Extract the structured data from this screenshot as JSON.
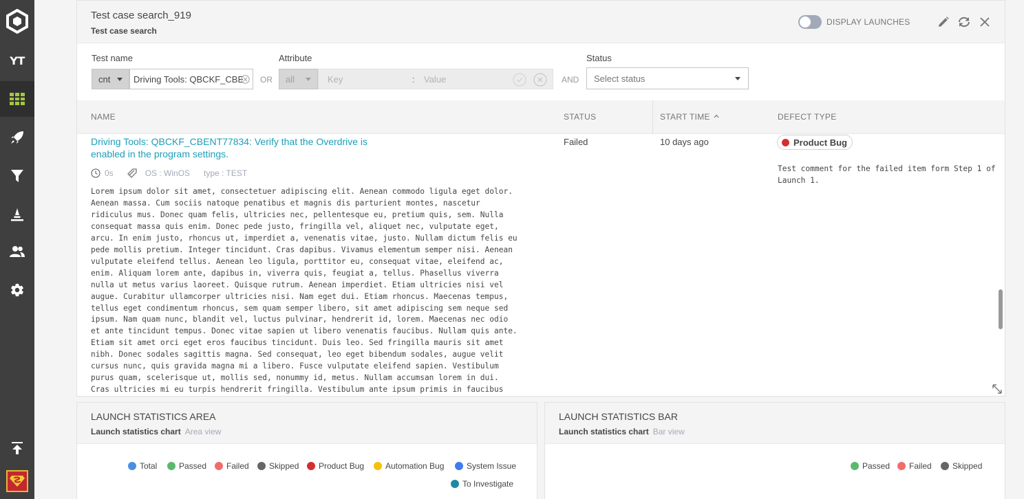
{
  "sidebar": {
    "project_initials": "YT",
    "items": [
      {
        "name": "dashboards",
        "icon": "dashboard-grid-icon",
        "active": true
      },
      {
        "name": "launches",
        "icon": "rocket-icon"
      },
      {
        "name": "filters",
        "icon": "filter-icon"
      },
      {
        "name": "debug",
        "icon": "debug-cone-icon"
      },
      {
        "name": "members",
        "icon": "members-icon"
      },
      {
        "name": "settings",
        "icon": "gear-icon"
      }
    ],
    "colors": {
      "bg": "#3f3f3f",
      "active_icon": "#a3c644"
    }
  },
  "test_case_widget": {
    "title": "Test case search_919",
    "subtitle": "Test case search",
    "display_launches_label": "DISPLAY LAUNCHES",
    "filters": {
      "test_name_label": "Test name",
      "test_name_condition": "cnt",
      "test_name_value": "Driving Tools: QBCKF_CBE",
      "or_label": "OR",
      "attribute_label": "Attribute",
      "attribute_condition": "all",
      "key_placeholder": "Key",
      "separator": ":",
      "value_placeholder": "Value",
      "and_label": "AND",
      "status_label": "Status",
      "status_placeholder": "Select status"
    },
    "columns": {
      "name": "NAME",
      "status": "STATUS",
      "start_time": "START TIME",
      "defect_type": "DEFECT TYPE"
    },
    "row": {
      "name": "Driving Tools: QBCKF_CBENT77834: Verify that the Overdrive is enabled in the program settings.",
      "duration": "0s",
      "attr_os": "OS : WinOS",
      "attr_type": "type : TEST",
      "description": "Lorem ipsum dolor sit amet, consectetuer adipiscing elit. Aenean commodo ligula eget dolor.\nAenean massa. Cum sociis natoque penatibus et magnis dis parturient montes, nascetur\nridiculus mus. Donec quam felis, ultricies nec, pellentesque eu, pretium quis, sem. Nulla\nconsequat massa quis enim. Donec pede justo, fringilla vel, aliquet nec, vulputate eget,\narcu. In enim justo, rhoncus ut, imperdiet a, venenatis vitae, justo. Nullam dictum felis eu\npede mollis pretium. Integer tincidunt. Cras dapibus. Vivamus elementum semper nisi. Aenean\nvulputate eleifend tellus. Aenean leo ligula, porttitor eu, consequat vitae, eleifend ac,\nenim. Aliquam lorem ante, dapibus in, viverra quis, feugiat a, tellus. Phasellus viverra\nnulla ut metus varius laoreet. Quisque rutrum. Aenean imperdiet. Etiam ultricies nisi vel\naugue. Curabitur ullamcorper ultricies nisi. Nam eget dui. Etiam rhoncus. Maecenas tempus,\ntellus eget condimentum rhoncus, sem quam semper libero, sit amet adipiscing sem neque sed\nipsum. Nam quam nunc, blandit vel, luctus pulvinar, hendrerit id, lorem. Maecenas nec odio\net ante tincidunt tempus. Donec vitae sapien ut libero venenatis faucibus. Nullam quis ante.\nEtiam sit amet orci eget eros faucibus tincidunt. Duis leo. Sed fringilla mauris sit amet\nnibh. Donec sodales sagittis magna. Sed consequat, leo eget bibendum sodales, augue velit\ncursus nunc, quis gravida magna mi a libero. Fusce vulputate eleifend sapien. Vestibulum\npurus quam, scelerisque ut, mollis sed, nonummy id, metus. Nullam accumsan lorem in dui.\nCras ultricies mi eu turpis hendrerit fringilla. Vestibulum ante ipsum primis in faucibus",
      "status": "Failed",
      "start_time": "10 days ago",
      "defect_type": "Product Bug",
      "defect_color": "#d32f2f",
      "defect_comment": "Test comment for the failed item form Step 1 of Launch 1."
    }
  },
  "area_widget": {
    "title": "LAUNCH STATISTICS AREA",
    "subtitle": "Launch statistics chart",
    "view": "Area view",
    "legend": [
      {
        "label": "Total",
        "color": "#4a90e2"
      },
      {
        "label": "Passed",
        "color": "#5bb96e"
      },
      {
        "label": "Failed",
        "color": "#f36c6c"
      },
      {
        "label": "Skipped",
        "color": "#666666"
      },
      {
        "label": "Product Bug",
        "color": "#d32f2f"
      },
      {
        "label": "Automation Bug",
        "color": "#f7c10a"
      },
      {
        "label": "System Issue",
        "color": "#3f7cf2"
      },
      {
        "label": "To Investigate",
        "color": "#1d8aa3"
      }
    ]
  },
  "bar_widget": {
    "title": "LAUNCH STATISTICS BAR",
    "subtitle": "Launch statistics chart",
    "view": "Bar view",
    "legend": [
      {
        "label": "Passed",
        "color": "#5bb96e"
      },
      {
        "label": "Failed",
        "color": "#f36c6c"
      },
      {
        "label": "Skipped",
        "color": "#666666"
      }
    ]
  }
}
